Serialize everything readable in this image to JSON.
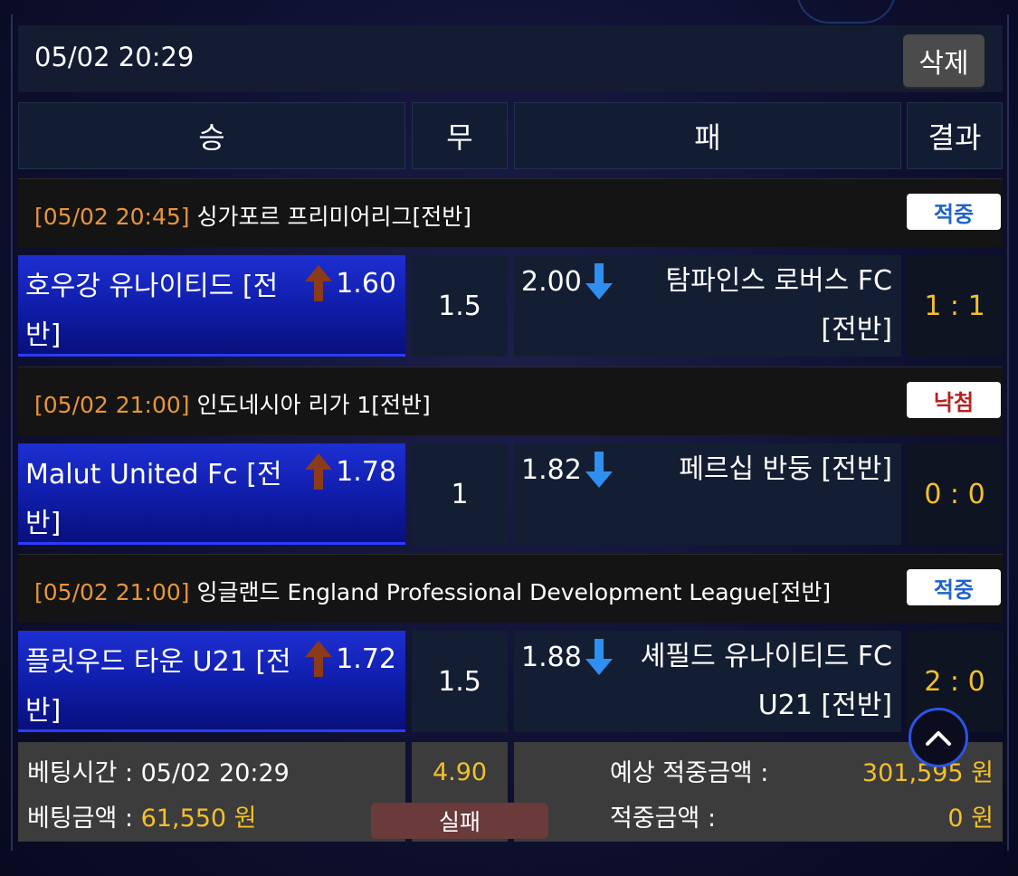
{
  "topbar": {
    "time": "05/02 20:29",
    "delete_label": "삭제"
  },
  "headers": {
    "win": "승",
    "draw": "무",
    "lose": "패",
    "result": "결과"
  },
  "games": [
    {
      "league_time": "[05/02 20:45]",
      "league_name": "싱가포르 프리미어리그[전반]",
      "result": "적중",
      "result_type": "win",
      "home_team": "호우강 유나이티드 [전반]",
      "home_odds": "1.60",
      "home_arrow": "up",
      "draw_value": "1.5",
      "away_odds": "2.00",
      "away_arrow": "down",
      "away_team": "탐파인스 로버스 FC [전반]",
      "score": "1 : 1"
    },
    {
      "league_time": "[05/02 21:00]",
      "league_name": "인도네시아 리가 1[전반]",
      "result": "낙첨",
      "result_type": "lose",
      "home_team": "Malut United Fc [전반]",
      "home_odds": "1.78",
      "home_arrow": "up",
      "draw_value": "1",
      "away_odds": "1.82",
      "away_arrow": "down",
      "away_team": "페르십 반둥 [전반]",
      "score": "0 : 0"
    },
    {
      "league_time": "[05/02 21:00]",
      "league_name": "잉글랜드 England Professional Development League[전반]",
      "result": "적중",
      "result_type": "win",
      "home_team": "플릿우드 타운 U21 [전반]",
      "home_odds": "1.72",
      "home_arrow": "up",
      "draw_value": "1.5",
      "away_odds": "1.88",
      "away_arrow": "down",
      "away_team": "셰필드 유나이티드 FC U21 [전반]",
      "score": "2 : 0"
    }
  ],
  "footer": {
    "bet_time_label": "베팅시간 : ",
    "bet_time": "05/02 20:29",
    "bet_amount_label": "베팅금액 : ",
    "bet_amount": "61,550 원",
    "total_odds": "4.90",
    "status": "실패",
    "expected_label": "예상 적중금액 :",
    "expected_value": "301,595 원",
    "hit_label": "적중금액 :",
    "hit_value": "0 원"
  },
  "icons": {
    "up": "arrow-up-icon",
    "down": "arrow-down-icon",
    "scroll": "chevron-up-icon"
  },
  "colors": {
    "home_bg": "#1d2fd2",
    "score": "#f3c02b",
    "league_time": "#e8953a",
    "up_arrow": "#8b3a1a",
    "down_arrow": "#2f8ff0"
  }
}
